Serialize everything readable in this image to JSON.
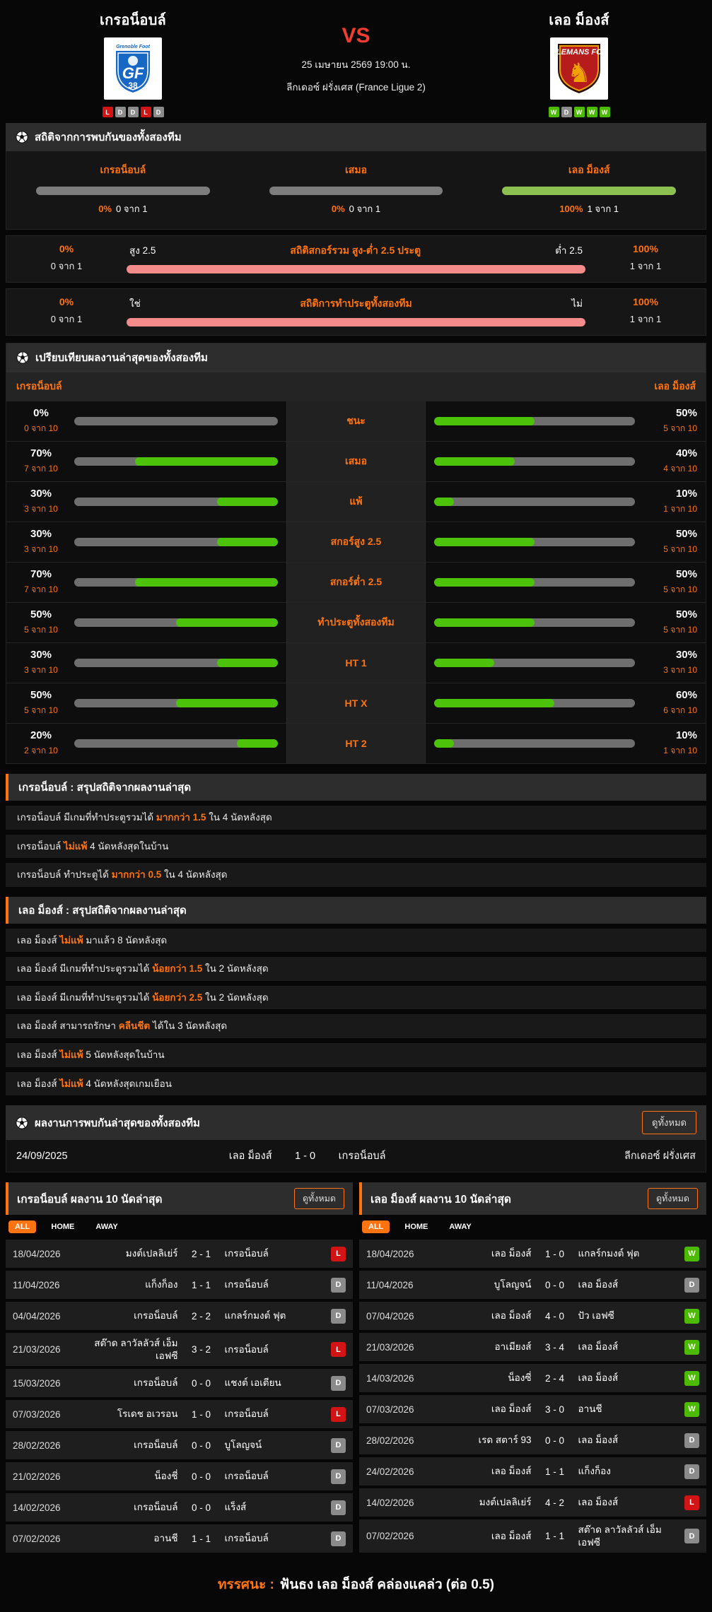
{
  "colors": {
    "accent": "#ff7411",
    "green": "#4cc30a",
    "h2h_green": "#8cc152",
    "pink": "#f48b8b",
    "win": "#4cbb00",
    "draw": "#8b8b8b",
    "lose": "#d21414",
    "vs_red": "#f23d31"
  },
  "header": {
    "home": {
      "name": "เกรอน็อบล์",
      "logo_title": "Grenoble Foot",
      "logo_initials": "GF",
      "logo_number": "38",
      "form": [
        "L",
        "D",
        "D",
        "L",
        "D"
      ]
    },
    "away": {
      "name": "เลอ ม็องส์",
      "logo_title": "LEMANS FC",
      "form": [
        "W",
        "D",
        "W",
        "W",
        "W"
      ]
    },
    "vs": "VS",
    "datetime": "25 เมษายน 2569 19:00 น.",
    "league": "ลีกเดอซ์ ฝรั่งเศส (France Ligue 2)"
  },
  "h2h_stats": {
    "title": "สถิติจากการพบกันของทั้งสองทีม",
    "columns": [
      {
        "label": "เกรอน็อบล์",
        "percent": "0%",
        "count": "0 จาก 1",
        "value": 0
      },
      {
        "label": "เสมอ",
        "percent": "0%",
        "count": "0 จาก 1",
        "value": 0
      },
      {
        "label": "เลอ ม็องส์",
        "percent": "100%",
        "count": "1 จาก 1",
        "value": 100
      }
    ]
  },
  "ou_stats": {
    "title": "สถิติสกอร์รวม สูง-ต่ำ 2.5 ประตู",
    "left_percent": "0%",
    "left_count": "0 จาก 1",
    "left_label": "สูง 2.5",
    "right_label": "ต่ำ 2.5",
    "right_percent": "100%",
    "right_count": "1 จาก 1"
  },
  "btts_stats": {
    "title": "สถิติการทำประตูทั้งสองทีม",
    "left_percent": "0%",
    "left_count": "0 จาก 1",
    "left_label": "ใช่",
    "right_label": "ไม่",
    "right_percent": "100%",
    "right_count": "1 จาก 1"
  },
  "comparison": {
    "title": "เปรียบเทียบผลงานล่าสุดของทั้งสองทีม",
    "home_label": "เกรอน็อบล์",
    "away_label": "เลอ ม็องส์",
    "rows": [
      {
        "label": "ชนะ",
        "home": {
          "percent": "0%",
          "count": "0 จาก 10",
          "value": 0
        },
        "away": {
          "percent": "50%",
          "count": "5 จาก 10",
          "value": 50
        }
      },
      {
        "label": "เสมอ",
        "home": {
          "percent": "70%",
          "count": "7 จาก 10",
          "value": 70
        },
        "away": {
          "percent": "40%",
          "count": "4 จาก 10",
          "value": 40
        }
      },
      {
        "label": "แพ้",
        "home": {
          "percent": "30%",
          "count": "3 จาก 10",
          "value": 30
        },
        "away": {
          "percent": "10%",
          "count": "1 จาก 10",
          "value": 10
        }
      },
      {
        "label": "สกอร์สูง 2.5",
        "home": {
          "percent": "30%",
          "count": "3 จาก 10",
          "value": 30
        },
        "away": {
          "percent": "50%",
          "count": "5 จาก 10",
          "value": 50
        }
      },
      {
        "label": "สกอร์ต่ำ 2.5",
        "home": {
          "percent": "70%",
          "count": "7 จาก 10",
          "value": 70
        },
        "away": {
          "percent": "50%",
          "count": "5 จาก 10",
          "value": 50
        }
      },
      {
        "label": "ทำประตูทั้งสองทีม",
        "home": {
          "percent": "50%",
          "count": "5 จาก 10",
          "value": 50
        },
        "away": {
          "percent": "50%",
          "count": "5 จาก 10",
          "value": 50
        }
      },
      {
        "label": "HT 1",
        "home": {
          "percent": "30%",
          "count": "3 จาก 10",
          "value": 30
        },
        "away": {
          "percent": "30%",
          "count": "3 จาก 10",
          "value": 30
        }
      },
      {
        "label": "HT X",
        "home": {
          "percent": "50%",
          "count": "5 จาก 10",
          "value": 50
        },
        "away": {
          "percent": "60%",
          "count": "6 จาก 10",
          "value": 60
        }
      },
      {
        "label": "HT 2",
        "home": {
          "percent": "20%",
          "count": "2 จาก 10",
          "value": 20
        },
        "away": {
          "percent": "10%",
          "count": "1 จาก 10",
          "value": 10
        }
      }
    ]
  },
  "home_summary": {
    "title": "เกรอน็อบล์ : สรุปสถิติจากผลงานล่าสุด",
    "rows": [
      {
        "segments": [
          {
            "t": "เกรอน็อบล์  มีเกมที่ทำประตูรวมได้ "
          },
          {
            "t": "มากกว่า 1.5",
            "hl": true
          },
          {
            "t": " ใน 4 นัดหลังสุด"
          }
        ]
      },
      {
        "segments": [
          {
            "t": "เกรอน็อบล์  "
          },
          {
            "t": "ไม่แพ้",
            "hl": true
          },
          {
            "t": " 4  นัดหลังสุดในบ้าน"
          }
        ]
      },
      {
        "segments": [
          {
            "t": "เกรอน็อบล์  ทำประตูได้ "
          },
          {
            "t": "มากกว่า 0.5",
            "hl": true
          },
          {
            "t": " ใน 4 นัดหลังสุด"
          }
        ]
      }
    ]
  },
  "away_summary": {
    "title": "เลอ ม็องส์ : สรุปสถิติจากผลงานล่าสุด",
    "rows": [
      {
        "segments": [
          {
            "t": "เลอ ม็องส์  "
          },
          {
            "t": "ไม่แพ้",
            "hl": true
          },
          {
            "t": " มาแล้ว 8 นัดหลังสุด"
          }
        ]
      },
      {
        "segments": [
          {
            "t": "เลอ ม็องส์  มีเกมที่ทำประตูรวมได้ "
          },
          {
            "t": "น้อยกว่า 1.5",
            "hl": true
          },
          {
            "t": " ใน 2 นัดหลังสุด"
          }
        ]
      },
      {
        "segments": [
          {
            "t": "เลอ ม็องส์  มีเกมที่ทำประตูรวมได้ "
          },
          {
            "t": "น้อยกว่า 2.5",
            "hl": true
          },
          {
            "t": " ใน 2 นัดหลังสุด"
          }
        ]
      },
      {
        "segments": [
          {
            "t": "เลอ ม็องส์  สามารถรักษา "
          },
          {
            "t": "คลีนชีต",
            "hl": true
          },
          {
            "t": " ได้ใน 3 นัดหลังสุด"
          }
        ]
      },
      {
        "segments": [
          {
            "t": "เลอ ม็องส์  "
          },
          {
            "t": "ไม่แพ้",
            "hl": true
          },
          {
            "t": " 5  นัดหลังสุดในบ้าน"
          }
        ]
      },
      {
        "segments": [
          {
            "t": "เลอ ม็องส์  "
          },
          {
            "t": "ไม่แพ้",
            "hl": true
          },
          {
            "t": " 4  นัดหลังสุดเกมเยือน"
          }
        ]
      }
    ]
  },
  "h2h_results": {
    "title": "ผลงานการพบกันล่าสุดของทั้งสองทีม",
    "view_all": "ดูทั้งหมด",
    "rows": [
      {
        "date": "24/09/2025",
        "home": "เลอ ม็องส์",
        "score": "1 - 0",
        "away": "เกรอน็อบล์",
        "league": "ลีกเดอซ์ ฝรั่งเศส"
      }
    ]
  },
  "recent_tables": [
    {
      "title": "เกรอน็อบล์ ผลงาน 10 นัดล่าสุด",
      "view_all": "ดูทั้งหมด",
      "tabs": [
        "ALL",
        "HOME",
        "AWAY"
      ],
      "active_tab": "ALL",
      "rows": [
        {
          "date": "18/04/2026",
          "home": "มงต์เปลลิเย่ร์",
          "score": "2 - 1",
          "away": "เกรอน็อบล์",
          "result": "L"
        },
        {
          "date": "11/04/2026",
          "home": "แก็งก็อง",
          "score": "1 - 1",
          "away": "เกรอน็อบล์",
          "result": "D"
        },
        {
          "date": "04/04/2026",
          "home": "เกรอน็อบล์",
          "score": "2 - 2",
          "away": "แกลร์กมงต์ ฟุต",
          "result": "D"
        },
        {
          "date": "21/03/2026",
          "home": "สต๊าด ลาวัลลัวส์ เอ็ม เอฟซี",
          "score": "3 - 2",
          "away": "เกรอน็อบล์",
          "result": "L"
        },
        {
          "date": "15/03/2026",
          "home": "เกรอน็อบล์",
          "score": "0 - 0",
          "away": "แชงต์ เอเตียน",
          "result": "D"
        },
        {
          "date": "07/03/2026",
          "home": "โรเดช อเวรอน",
          "score": "1 - 0",
          "away": "เกรอน็อบล์",
          "result": "L"
        },
        {
          "date": "28/02/2026",
          "home": "เกรอน็อบล์",
          "score": "0 - 0",
          "away": "บูโลญจน์",
          "result": "D"
        },
        {
          "date": "21/02/2026",
          "home": "น็องชี่",
          "score": "0 - 0",
          "away": "เกรอน็อบล์",
          "result": "D"
        },
        {
          "date": "14/02/2026",
          "home": "เกรอน็อบล์",
          "score": "0 - 0",
          "away": "แร็งส์",
          "result": "D"
        },
        {
          "date": "07/02/2026",
          "home": "อานชี",
          "score": "1 - 1",
          "away": "เกรอน็อบล์",
          "result": "D"
        }
      ]
    },
    {
      "title": "เลอ ม็องส์ ผลงาน 10 นัดล่าสุด",
      "view_all": "ดูทั้งหมด",
      "tabs": [
        "ALL",
        "HOME",
        "AWAY"
      ],
      "active_tab": "ALL",
      "rows": [
        {
          "date": "18/04/2026",
          "home": "เลอ ม็องส์",
          "score": "1 - 0",
          "away": "แกลร์กมงต์ ฟุต",
          "result": "W"
        },
        {
          "date": "11/04/2026",
          "home": "บูโลญจน์",
          "score": "0 - 0",
          "away": "เลอ ม็องส์",
          "result": "D"
        },
        {
          "date": "07/04/2026",
          "home": "เลอ ม็องส์",
          "score": "4 - 0",
          "away": "ปัว เอฟซี",
          "result": "W"
        },
        {
          "date": "21/03/2026",
          "home": "อาเมียงส์",
          "score": "3 - 4",
          "away": "เลอ ม็องส์",
          "result": "W"
        },
        {
          "date": "14/03/2026",
          "home": "น็องซี่",
          "score": "2 - 4",
          "away": "เลอ ม็องส์",
          "result": "W"
        },
        {
          "date": "07/03/2026",
          "home": "เลอ ม็องส์",
          "score": "3 - 0",
          "away": "อานชี",
          "result": "W"
        },
        {
          "date": "28/02/2026",
          "home": "เรด สตาร์ 93",
          "score": "0 - 0",
          "away": "เลอ ม็องส์",
          "result": "D"
        },
        {
          "date": "24/02/2026",
          "home": "เลอ ม็องส์",
          "score": "1 - 1",
          "away": "แก็งก็อง",
          "result": "D"
        },
        {
          "date": "14/02/2026",
          "home": "มงต์เปลลิเย่ร์",
          "score": "4 - 2",
          "away": "เลอ ม็องส์",
          "result": "L"
        },
        {
          "date": "07/02/2026",
          "home": "เลอ ม็องส์",
          "score": "1 - 1",
          "away": "สต๊าด ลาวัลลัวส์ เอ็ม เอฟซี",
          "result": "D"
        }
      ]
    }
  ],
  "footer": {
    "prefix": "ทรรศนะ :",
    "text": "ฟันธง เลอ ม็องส์ คล่องแคล่ว (ต่อ 0.5)"
  }
}
